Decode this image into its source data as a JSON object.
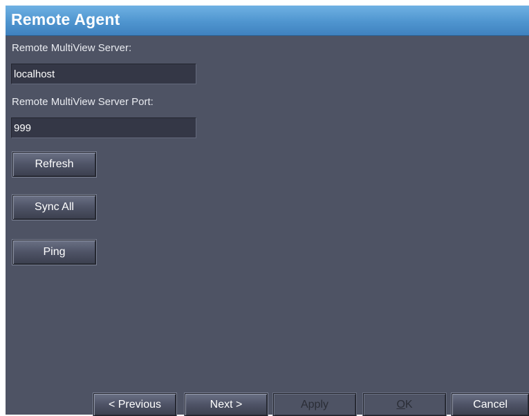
{
  "window": {
    "title": "Remote Agent"
  },
  "server": {
    "label": "Remote MultiView Server:",
    "value": "localhost"
  },
  "port": {
    "label": "Remote MultiView Server Port:",
    "value": "999"
  },
  "actions": {
    "refresh": "Refresh",
    "sync_all": "Sync All",
    "ping": "Ping"
  },
  "footer": {
    "previous": "< Previous",
    "next": "Next >",
    "apply": "Apply",
    "ok": "OK",
    "cancel": "Cancel",
    "apply_enabled": false,
    "ok_enabled": false
  },
  "colors": {
    "title_bar": "#4f95cf",
    "panel_background": "#4e5364",
    "field_background": "#343746"
  }
}
